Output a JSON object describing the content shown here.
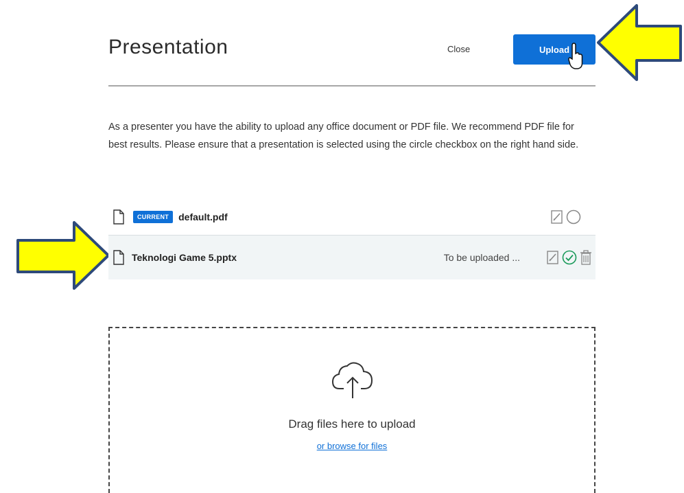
{
  "modal": {
    "title": "Presentation",
    "close_label": "Close",
    "upload_label": "Upload",
    "description": "As a presenter you have the ability to upload any office document or PDF file. We recommend PDF file for best results. Please ensure that a presentation is selected using the circle checkbox on the right hand side."
  },
  "files": [
    {
      "badge": "CURRENT",
      "name": "default.pdf",
      "status": ""
    },
    {
      "badge": "",
      "name": "Teknologi Game 5.pptx",
      "status": "To be uploaded ..."
    }
  ],
  "dropzone": {
    "text": "Drag files here to upload",
    "browse": "or browse for files"
  },
  "colors": {
    "accent": "#0f70d7",
    "arrow_fill": "#ffff00",
    "arrow_stroke": "#2e4a7a",
    "check": "#1a9a5a"
  },
  "icons": [
    "file-icon",
    "edit-icon",
    "circle-select-icon",
    "check-circle-icon",
    "trash-icon",
    "cloud-upload-icon",
    "hand-cursor-icon",
    "arrow-annotation"
  ]
}
